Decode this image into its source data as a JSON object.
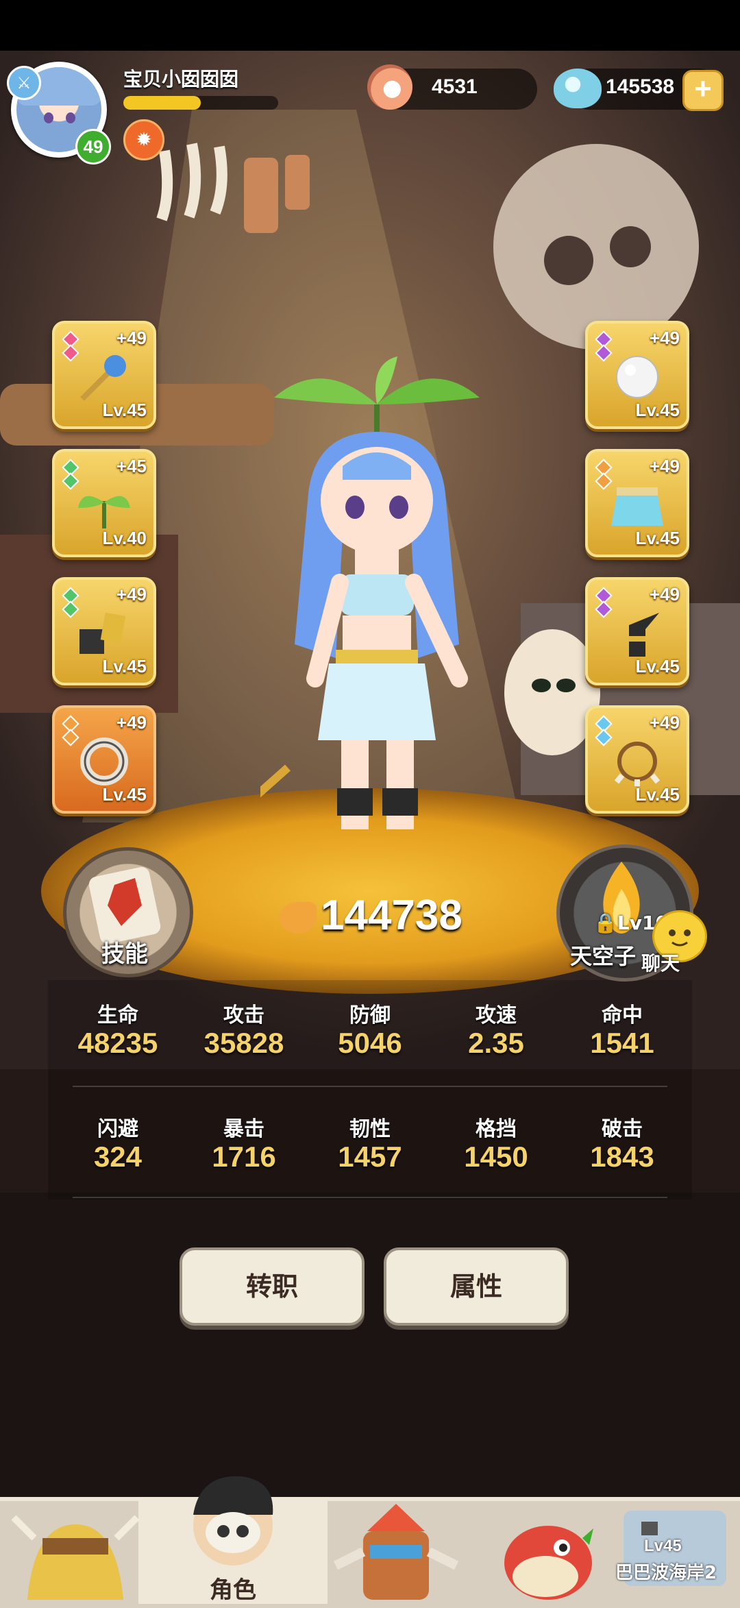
{
  "player": {
    "name": "宝贝小囡囡囡",
    "level": "49",
    "exp_fraction": 0.5
  },
  "resources": {
    "pearls": "4531",
    "gems": "145538",
    "add_symbol": "+"
  },
  "equipment_left": [
    {
      "plus": "+49",
      "level": "Lv.45",
      "item": "dragon-staff-icon",
      "gem_color": "#f05a8a"
    },
    {
      "plus": "+45",
      "level": "Lv.40",
      "item": "leaf-sprout-icon",
      "gem_color": "#52c46a"
    },
    {
      "plus": "+49",
      "level": "Lv.45",
      "item": "stone-block-icon",
      "gem_color": "#52c46a"
    },
    {
      "plus": "+49",
      "level": "Lv.45",
      "item": "stone-ring-icon",
      "gem_color": "#f0a040"
    }
  ],
  "equipment_right": [
    {
      "plus": "+49",
      "level": "Lv.45",
      "item": "pearl-orb-icon",
      "gem_color": "#b05ad8"
    },
    {
      "plus": "+49",
      "level": "Lv.45",
      "item": "skirt-icon",
      "gem_color": "#f0a040"
    },
    {
      "plus": "+49",
      "level": "Lv.45",
      "item": "horn-boot-icon",
      "gem_color": "#b05ad8"
    },
    {
      "plus": "+49",
      "level": "Lv.45",
      "item": "bone-bracelet-icon",
      "gem_color": "#6ac8f0"
    }
  ],
  "buttons": {
    "skill": "技能",
    "sky_lock": "Lv10",
    "sky": "天空子",
    "chat": "聊天",
    "transfer": "转职",
    "attributes": "属性"
  },
  "power": "144738",
  "stats_row1": [
    {
      "name": "生命",
      "value": "48235"
    },
    {
      "name": "攻击",
      "value": "35828"
    },
    {
      "name": "防御",
      "value": "5046"
    },
    {
      "name": "攻速",
      "value": "2.35"
    },
    {
      "name": "命中",
      "value": "1541"
    }
  ],
  "stats_row2": [
    {
      "name": "闪避",
      "value": "324"
    },
    {
      "name": "暴击",
      "value": "1716"
    },
    {
      "name": "韧性",
      "value": "1457"
    },
    {
      "name": "格挡",
      "value": "1450"
    },
    {
      "name": "破击",
      "value": "1843"
    }
  ],
  "nav": {
    "role_label": "角色",
    "locked_level": "Lv45",
    "locked_name": "巴巴波海岸2"
  }
}
